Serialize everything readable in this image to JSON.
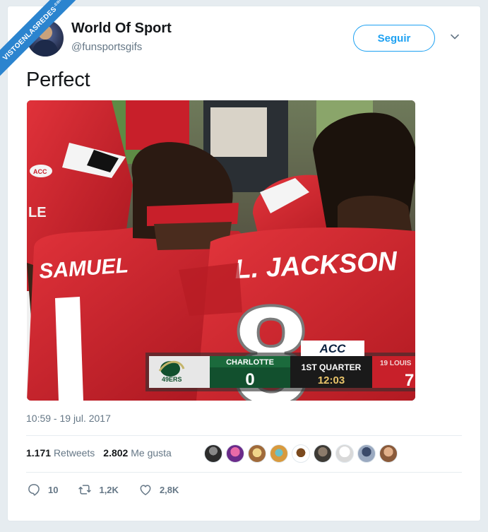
{
  "watermark": {
    "text": "VISTOENLASREDES",
    "suffix": ".com"
  },
  "account": {
    "name": "World Of Sport",
    "handle": "@funsportsgifs"
  },
  "follow_label": "Seguir",
  "tweet_text": "Perfect",
  "photo": {
    "jersey_left": "SAMUEL",
    "jersey_right": "L. JACKSON",
    "jersey_number": "8",
    "left_patch": "ACC",
    "left_partial": "LE",
    "score": {
      "team_left": "CHARLOTTE",
      "score_left": "0",
      "quarter": "1ST QUARTER",
      "clock": "12:03",
      "team_right": "19 LOUIS",
      "score_right": "7",
      "conference": "ACC",
      "logo_text": "49ERS"
    }
  },
  "timestamp": "10:59 - 19 jul. 2017",
  "stats": {
    "retweets_count": "1.171",
    "retweets_label": "Retweets",
    "likes_count": "2.802",
    "likes_label": "Me gusta"
  },
  "actions": {
    "replies": "10",
    "retweets": "1,2K",
    "likes": "2,8K"
  },
  "colors": {
    "accent": "#1da1f2",
    "muted": "#657786",
    "jersey_red": "#d0242f",
    "ribbon": "#2b84cf"
  }
}
